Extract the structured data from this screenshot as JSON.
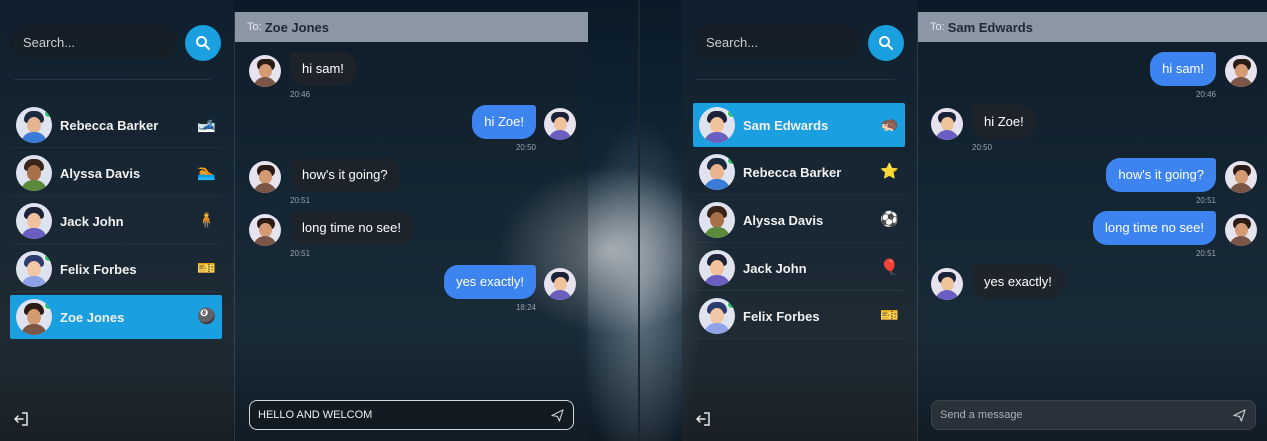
{
  "left_app": {
    "search": {
      "placeholder": "Search..."
    },
    "contacts": [
      {
        "name": "Rebecca Barker",
        "badge": "🎿",
        "online": true
      },
      {
        "name": "Alyssa Davis",
        "badge": "🏊",
        "online": false
      },
      {
        "name": "Jack John",
        "badge": "🧍",
        "online": false
      },
      {
        "name": "Felix Forbes",
        "badge": "🎫",
        "online": true
      },
      {
        "name": "Zoe Jones",
        "badge": "🎱",
        "online": true,
        "active": true
      }
    ],
    "chat": {
      "to_label": "To:",
      "to_name": "Zoe Jones",
      "messages": [
        {
          "text": "hi sam!",
          "time": "20:46",
          "direction": "in"
        },
        {
          "text": "hi Zoe!",
          "time": "20:50",
          "direction": "out"
        },
        {
          "text": "how's it going?",
          "time": "20:51",
          "direction": "in"
        },
        {
          "text": "long time no see!",
          "time": "20:51",
          "direction": "in"
        },
        {
          "text": "yes exactly!",
          "time": "18:24",
          "direction": "out"
        }
      ],
      "composer": {
        "value": "HELLO AND WELCOM",
        "placeholder": "Send a message"
      }
    }
  },
  "right_app": {
    "search": {
      "placeholder": "Search..."
    },
    "contacts": [
      {
        "name": "Sam Edwards",
        "badge": "🦔",
        "online": true,
        "active": true
      },
      {
        "name": "Rebecca Barker",
        "badge": "⭐",
        "online": true
      },
      {
        "name": "Alyssa Davis",
        "badge": "⚽",
        "online": false
      },
      {
        "name": "Jack John",
        "badge": "🎈",
        "online": false
      },
      {
        "name": "Felix Forbes",
        "badge": "🎫",
        "online": true
      }
    ],
    "chat": {
      "to_label": "To:",
      "to_name": "Sam Edwards",
      "messages": [
        {
          "text": "hi sam!",
          "time": "20:46",
          "direction": "out"
        },
        {
          "text": "hi Zoe!",
          "time": "20:50",
          "direction": "in"
        },
        {
          "text": "how's it going?",
          "time": "20:51",
          "direction": "out"
        },
        {
          "text": "long time no see!",
          "time": "20:51",
          "direction": "out"
        },
        {
          "text": "yes exactly!",
          "time": "",
          "direction": "in"
        }
      ],
      "composer": {
        "value": "",
        "placeholder": "Send a message"
      }
    }
  },
  "icons": {
    "search": "search-icon",
    "logout": "logout-icon",
    "send": "send-icon"
  },
  "colors": {
    "accent": "#1a9fe0",
    "outgoing_bubble": "#3d84f0",
    "incoming_bubble": "#1e242a",
    "online": "#27c46b",
    "header": "#96a2b0"
  }
}
